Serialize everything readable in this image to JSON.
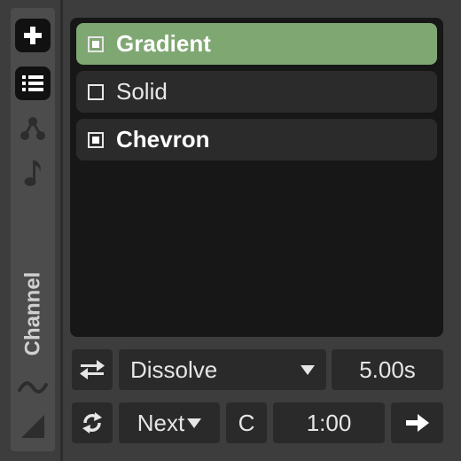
{
  "sidebar": {
    "add_icon": "plus-icon",
    "list_icon": "list-icon",
    "nodes_icon": "nodes-icon",
    "music_icon": "music-note-icon",
    "wave_icon": "wave-icon",
    "corner_icon": "corner-triangle-icon",
    "channel_label": "Channel"
  },
  "layers": [
    {
      "label": "Gradient",
      "checked": true,
      "selected": true
    },
    {
      "label": "Solid",
      "checked": false,
      "selected": false
    },
    {
      "label": "Chevron",
      "checked": true,
      "selected": false
    }
  ],
  "transition": {
    "swap_icon": "swap-arrows-icon",
    "effect": "Dissolve",
    "duration": "5.00s"
  },
  "playback": {
    "loop_icon": "loop-icon",
    "mode": "Next",
    "clear_label": "C",
    "time": "1:00",
    "go_icon": "arrow-right-icon"
  },
  "colors": {
    "selected_row": "#7fa772",
    "panel": "#171717",
    "control": "#2a2a2a"
  }
}
